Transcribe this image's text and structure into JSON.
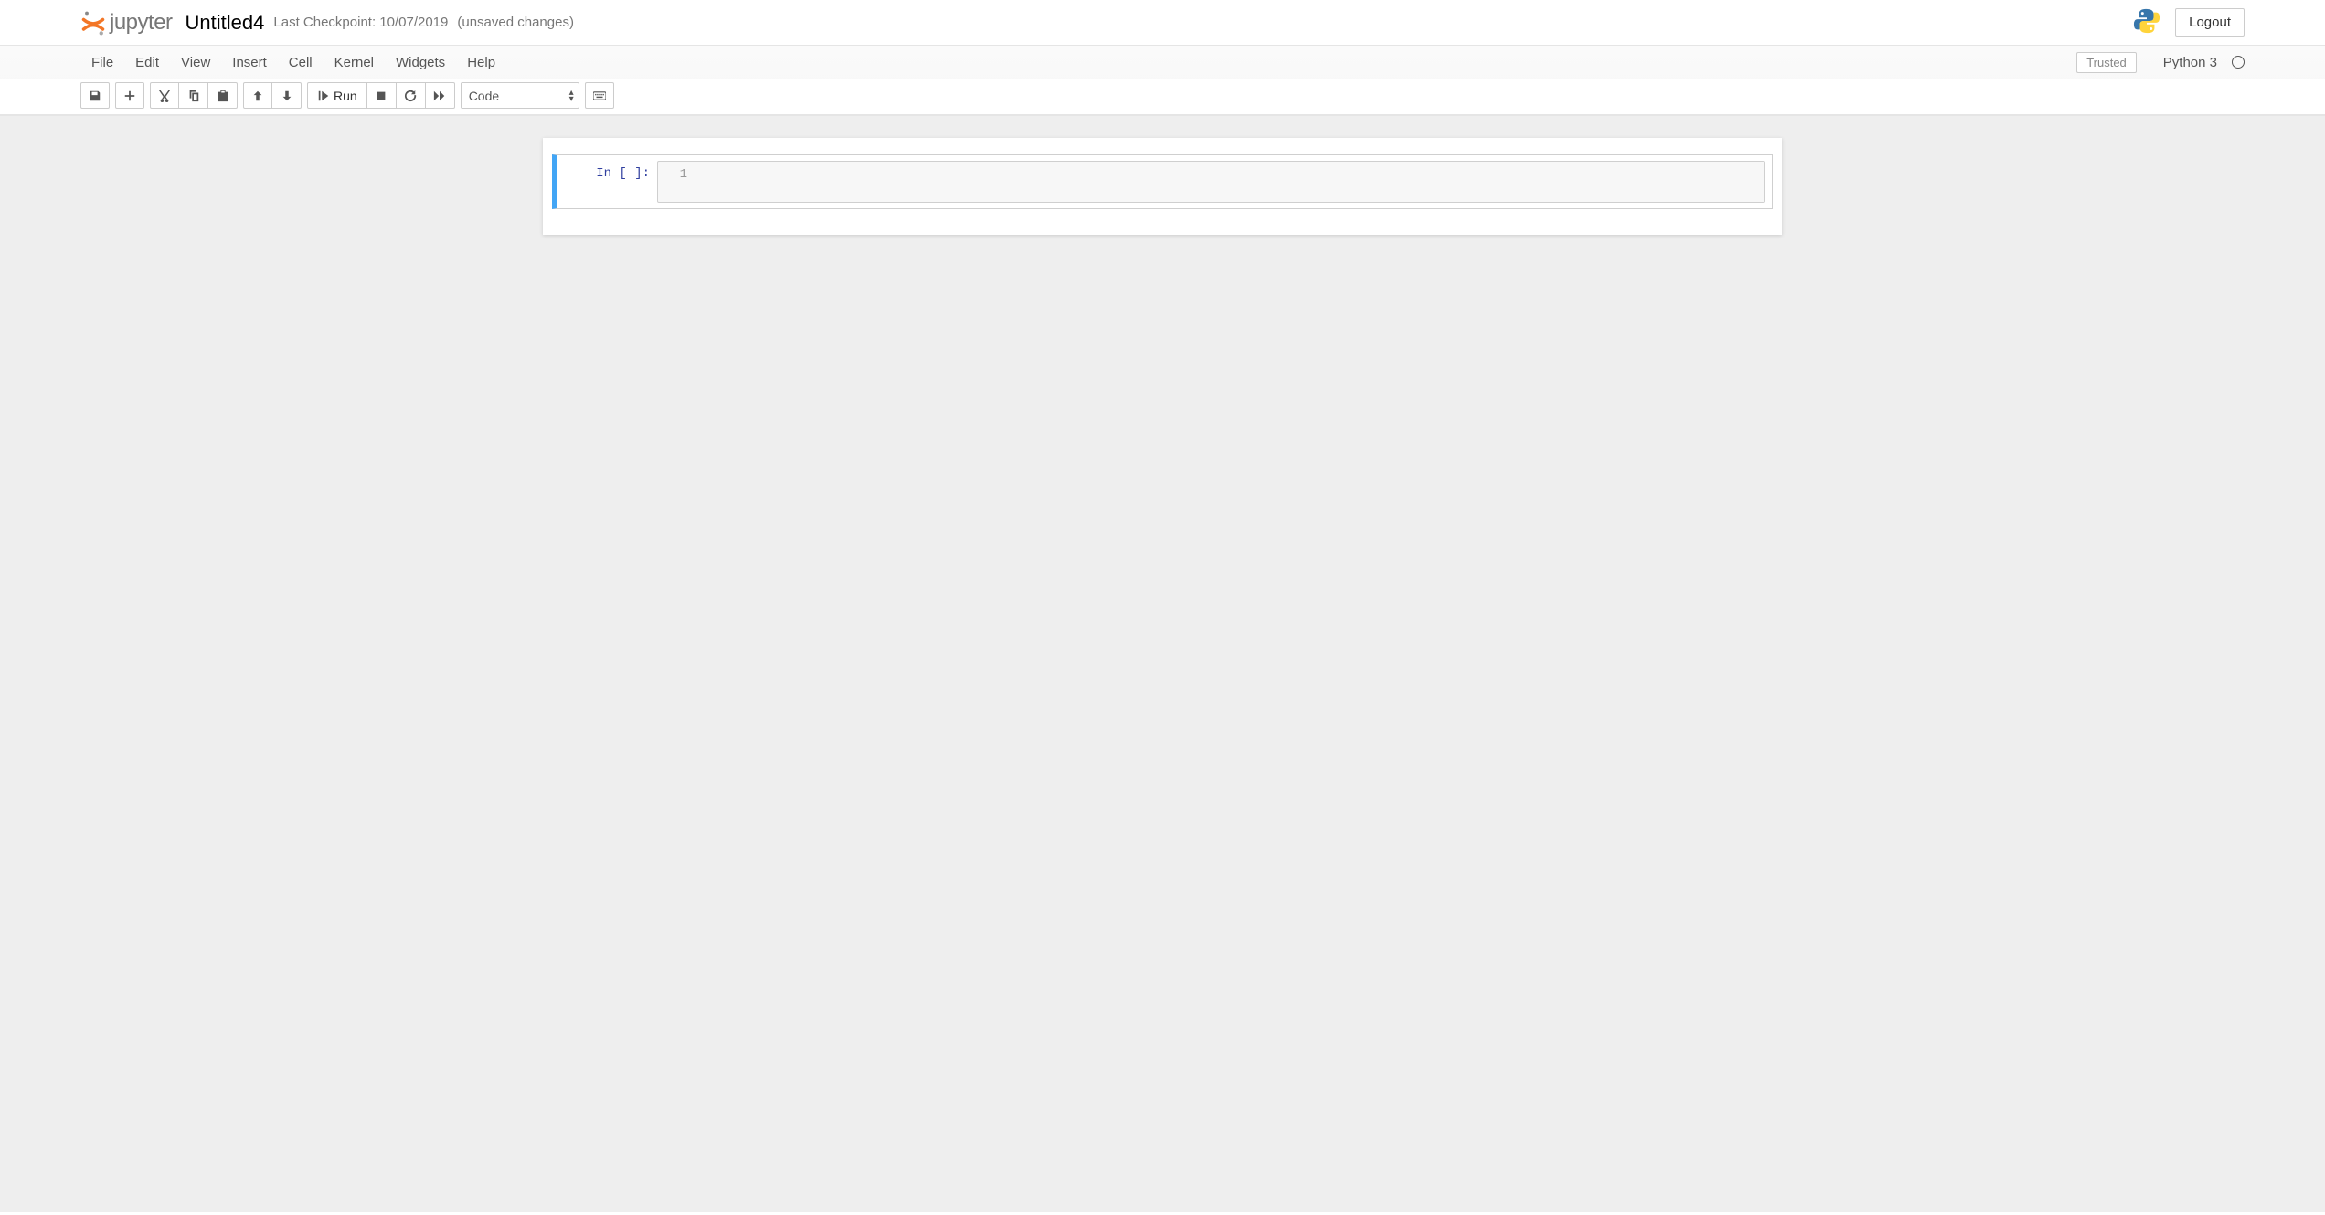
{
  "header": {
    "logo_text": "jupyter",
    "notebook_title": "Untitled4",
    "checkpoint_label": "Last Checkpoint: 10/07/2019",
    "unsaved_label": "(unsaved changes)",
    "logout_label": "Logout"
  },
  "menubar": {
    "items": [
      "File",
      "Edit",
      "View",
      "Insert",
      "Cell",
      "Kernel",
      "Widgets",
      "Help"
    ],
    "trusted_label": "Trusted",
    "kernel_name": "Python 3"
  },
  "toolbar": {
    "run_label": "Run",
    "cell_type_selected": "Code",
    "icons": {
      "save": "save-icon",
      "add": "plus-icon",
      "cut": "scissors-icon",
      "copy": "copy-icon",
      "paste": "paste-icon",
      "up": "arrow-up-icon",
      "down": "arrow-down-icon",
      "run": "play-step-icon",
      "stop": "stop-icon",
      "restart": "restart-icon",
      "restart_run": "fast-forward-icon",
      "command_palette": "keyboard-icon"
    }
  },
  "cells": [
    {
      "prompt": "In [ ]:",
      "line_number": "1",
      "code": ""
    }
  ]
}
